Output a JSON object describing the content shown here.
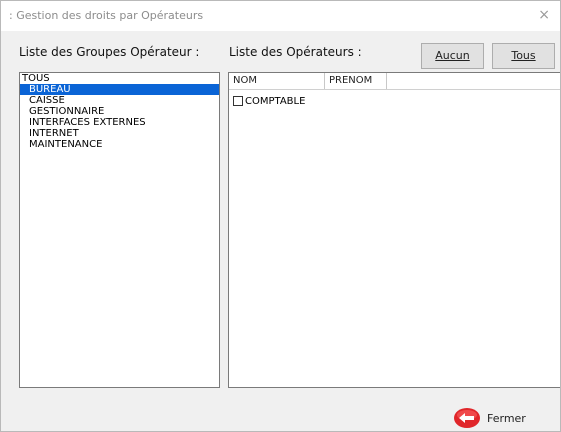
{
  "window": {
    "title": ": Gestion des droits par Opérateurs",
    "close_symbol": "×"
  },
  "labels": {
    "groups": "Liste des Groupes Opérateur :",
    "operators": "Liste des Opérateurs :"
  },
  "buttons": {
    "none": "Aucun",
    "all": "Tous",
    "close": "Fermer"
  },
  "groups": {
    "root": "TOUS",
    "items": [
      "BUREAU",
      "CAISSE",
      "GESTIONNAIRE",
      "INTERFACES EXTERNES",
      "INTERNET",
      "MAINTENANCE"
    ],
    "selected": "BUREAU"
  },
  "operators": {
    "columns": [
      "NOM",
      "PRENOM"
    ],
    "rows": [
      {
        "nom": "COMPTABLE",
        "prenom": "",
        "checked": false
      }
    ]
  },
  "colors": {
    "selection": "#0a64d6",
    "close_icon": "#e0262a"
  }
}
